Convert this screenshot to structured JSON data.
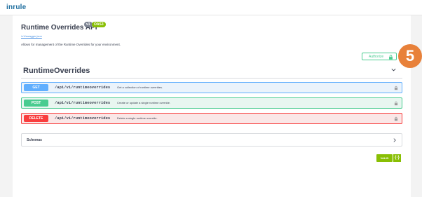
{
  "topbar": {
    "brand": "inrule"
  },
  "api": {
    "title": "Runtime Overrides API",
    "version_badge": "v1",
    "oas_badge": "OAS3",
    "spec_link": "/v1/swagger.json",
    "description": "Allows for management of the Runtime Overrides for your environment."
  },
  "authorize": {
    "label": "Authorize"
  },
  "step": {
    "number": "5"
  },
  "section": {
    "title": "RuntimeOverrides"
  },
  "operations": [
    {
      "method": "GET",
      "path": "/api/v1/runtimeoverrides",
      "summary": "Get a collection of runtime overrides."
    },
    {
      "method": "POST",
      "path": "/api/v1/runtimeoverrides",
      "summary": "Create or update a single runtime override."
    },
    {
      "method": "DELETE",
      "path": "/api/v1/runtimeoverrides",
      "summary": "Delete a single runtime override."
    }
  ],
  "schemas": {
    "label": "Schemas"
  },
  "validator": {
    "label": "VALID",
    "icon": "{-}"
  },
  "colors": {
    "get": "#61affe",
    "post": "#49cc90",
    "delete": "#f93e3e",
    "step_badge": "#e8813a",
    "valid": "#89bf04"
  },
  "icons": [
    "lock-icon",
    "chevron-down-icon",
    "chevron-right-icon"
  ]
}
